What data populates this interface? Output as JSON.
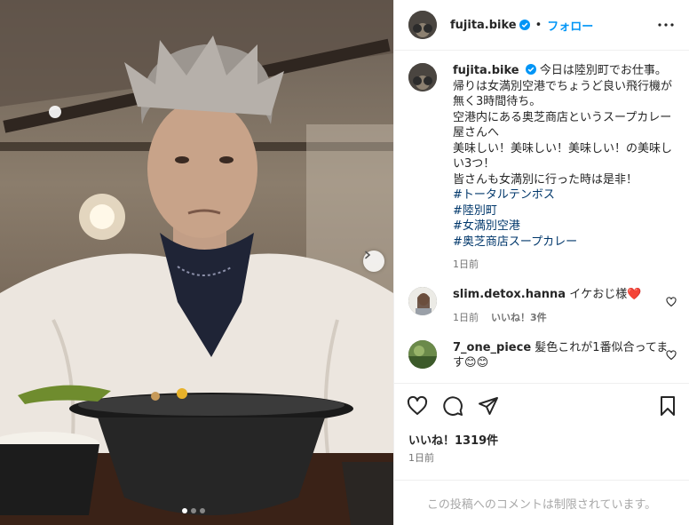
{
  "post": {
    "username": "fujita.bike",
    "follow_label": "フォロー",
    "separator": "•",
    "caption_lines": [
      "今日は陸別町でお仕事。",
      "帰りは女満別空港でちょうど良い飛行機が無く3時間待ち。",
      "空港内にある奥芝商店というスープカレー屋さんへ",
      "美味しい！美味しい！美味しい！の美味しい3つ！",
      "皆さんも女満別に行った時は是非！"
    ],
    "hashtags": [
      "#トータルテンボス",
      "#陸別町",
      "#女満別空港",
      "#奥芝商店スープカレー"
    ],
    "caption_time": "1日前",
    "likes": "いいね！1319件",
    "post_time": "1日前",
    "comments_restricted": "この投稿へのコメントは制限されています。"
  },
  "comments": [
    {
      "username": "slim.detox.hanna",
      "text": "イケおじ様",
      "emoji": "❤️",
      "time": "1日前",
      "likes": "いいね！3件"
    },
    {
      "username": "7_one_piece",
      "text": "髪色これが1番似合ってます",
      "emoji": "😊😊"
    }
  ],
  "carousel": {
    "total": 3,
    "current": 1
  },
  "colors": {
    "accent": "#0095f6",
    "verified": "#0095f6",
    "heart": "#e0245e",
    "hashtag": "#00376b"
  },
  "icons": [
    "more-options-icon",
    "heart-icon",
    "comment-icon",
    "share-icon",
    "save-icon",
    "chevron-right-icon",
    "verified-badge-icon"
  ]
}
